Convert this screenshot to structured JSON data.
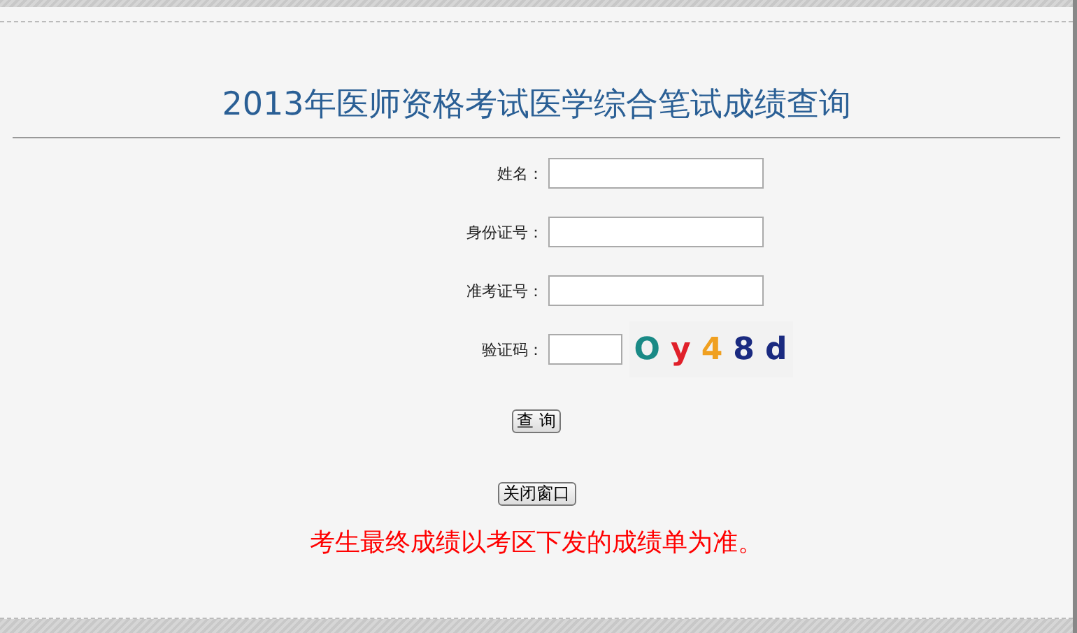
{
  "title": "2013年医师资格考试医学综合笔试成绩查询",
  "fields": [
    {
      "label": "姓名：",
      "kind": "text"
    },
    {
      "label": "身份证号：",
      "kind": "text"
    },
    {
      "label": "准考证号：",
      "kind": "text"
    },
    {
      "label": "验证码：",
      "kind": "captcha"
    }
  ],
  "captcha": [
    {
      "text": "O",
      "color": "#1a8a86"
    },
    {
      "text": "y",
      "color": "#e0202a"
    },
    {
      "text": "4",
      "color": "#f0a020"
    },
    {
      "text": "8",
      "color": "#1a2a80"
    },
    {
      "text": "d",
      "color": "#1a2a80"
    }
  ],
  "buttons": [
    {
      "label": "查 询"
    },
    {
      "label": "关闭窗口"
    }
  ],
  "notice": "考生最终成绩以考区下发的成绩单为准。"
}
